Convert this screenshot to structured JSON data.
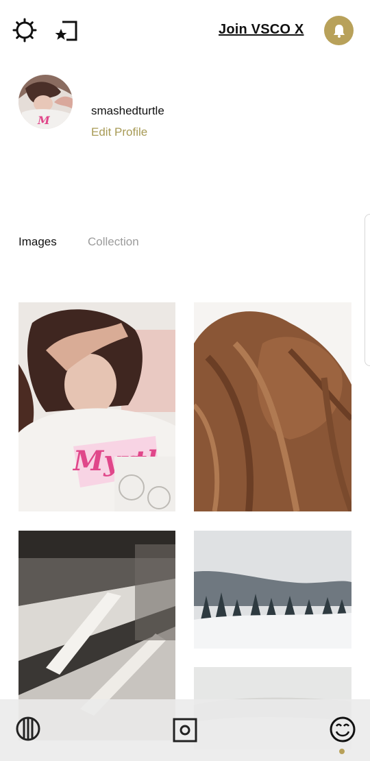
{
  "header": {
    "join_label": "Join VSCO X",
    "icons": {
      "settings": "gear-icon",
      "studio": "studio-icon",
      "notifications": "bell-icon"
    }
  },
  "profile": {
    "username": "smashedturtle",
    "edit_label": "Edit Profile"
  },
  "tabs": [
    {
      "label": "Images",
      "active": true
    },
    {
      "label": "Collection",
      "active": false
    }
  ],
  "images": [
    {
      "subject": "selfie in pink shirt"
    },
    {
      "subject": "hair bun close-up"
    },
    {
      "subject": "marble stairs with shadows"
    },
    {
      "subject": "snowy forest landscape"
    },
    {
      "subject": "hazy winter hills"
    }
  ],
  "bottom_nav": {
    "feed": "feed-icon",
    "studio": "studio-icon",
    "profile": "smiley-icon"
  },
  "colors": {
    "accent": "#b8a15a",
    "edit_text": "#a79a55"
  }
}
